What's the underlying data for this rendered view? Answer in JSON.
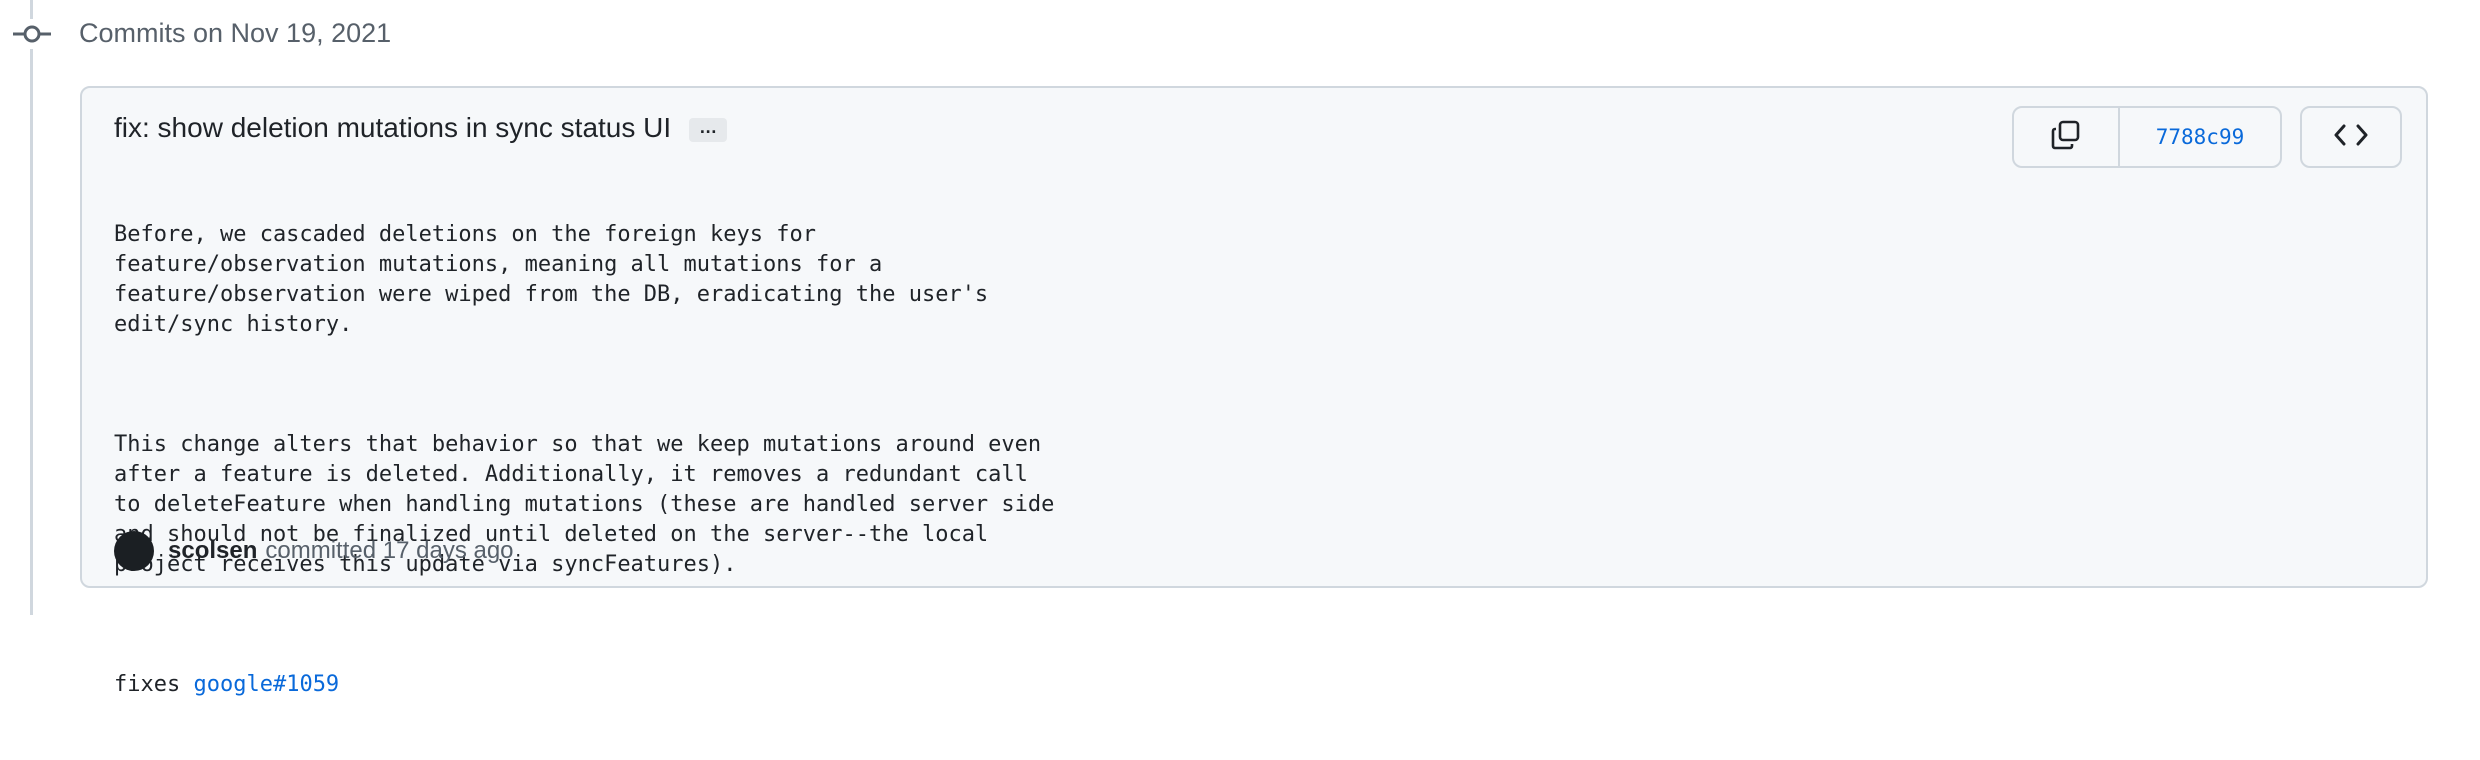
{
  "group": {
    "title": "Commits on Nov 19, 2021"
  },
  "commit": {
    "title": "fix: show deletion mutations in sync status UI",
    "ellipsis_label": "…",
    "body_paragraph_1": "Before, we cascaded deletions on the foreign keys for\nfeature/observation mutations, meaning all mutations for a\nfeature/observation were wiped from the DB, eradicating the user's\nedit/sync history.",
    "body_paragraph_2": "This change alters that behavior so that we keep mutations around even\nafter a feature is deleted. Additionally, it removes a redundant call\nto deleteFeature when handling mutations (these are handled server side\nand should not be finalized until deleted on the server--the local\nproject receives this update via syncFeatures).",
    "fixes_prefix": "fixes ",
    "fixes_link": "google#1059",
    "author": "scolsen",
    "committed_text": "committed 17 days ago",
    "sha": "7788c99"
  },
  "icons": {
    "timeline": "git-commit-icon",
    "copy": "copy-icon",
    "browse": "code-icon"
  },
  "colors": {
    "link": "#0969da",
    "border": "#d0d7de",
    "box_background": "#f6f8fa",
    "muted_text": "#57606a"
  }
}
